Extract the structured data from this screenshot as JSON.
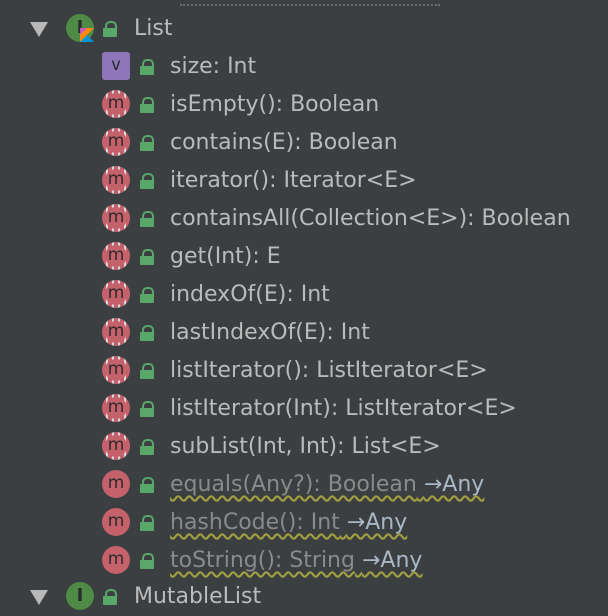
{
  "tree": {
    "class_node": {
      "icon": "kotlin-interface-icon",
      "icon_letter": "I",
      "label": "List",
      "expanded": true
    },
    "members": [
      {
        "kind": "v",
        "label": "size: Int"
      },
      {
        "kind": "m",
        "label": "isEmpty(): Boolean"
      },
      {
        "kind": "m",
        "label": "contains(E): Boolean"
      },
      {
        "kind": "m",
        "label": "iterator(): Iterator<E>"
      },
      {
        "kind": "m",
        "label": "containsAll(Collection<E>): Boolean"
      },
      {
        "kind": "m",
        "label": "get(Int): E"
      },
      {
        "kind": "m",
        "label": "indexOf(E): Int"
      },
      {
        "kind": "m",
        "label": "lastIndexOf(E): Int"
      },
      {
        "kind": "m",
        "label": "listIterator(): ListIterator<E>"
      },
      {
        "kind": "m",
        "label": "listIterator(Int): ListIterator<E>"
      },
      {
        "kind": "m",
        "label": "subList(Int, Int): List<E>"
      },
      {
        "kind": "m-inherited",
        "label": "equals(Any?): Boolean",
        "from": "→Any"
      },
      {
        "kind": "m-inherited",
        "label": "hashCode(): Int",
        "from": "→Any"
      },
      {
        "kind": "m-inherited",
        "label": "toString(): String",
        "from": "→Any"
      }
    ],
    "next_class_node": {
      "label": "MutableList"
    },
    "icon_letters": {
      "v": "v",
      "m": "m"
    },
    "colors": {
      "background": "#3c3f41",
      "text": "#bbbbbb",
      "method": "#c5616b",
      "property": "#8f76ba",
      "lock": "#59a869"
    }
  }
}
